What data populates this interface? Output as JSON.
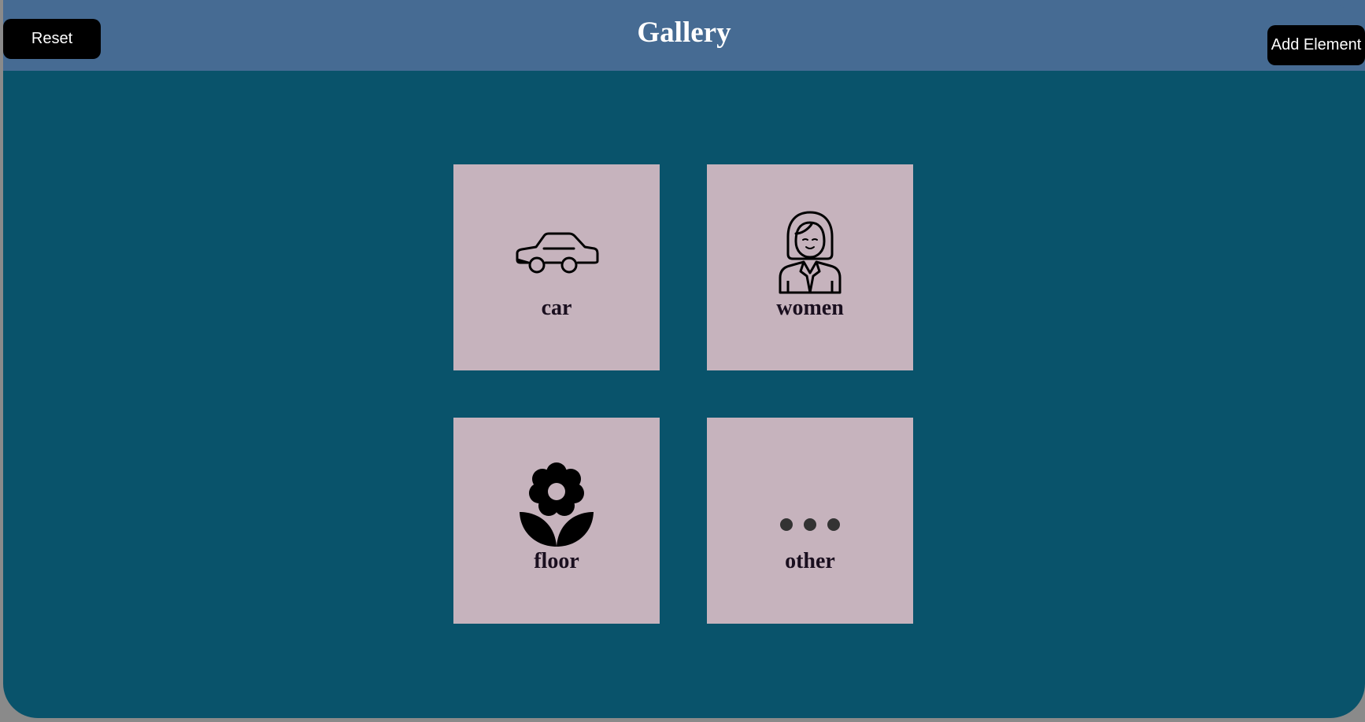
{
  "header": {
    "title": "Gallery",
    "reset_label": "Reset",
    "add_label": "Add Element"
  },
  "gallery": {
    "items": [
      {
        "label": "car",
        "icon": "car-icon"
      },
      {
        "label": "women",
        "icon": "woman-icon"
      },
      {
        "label": "floor",
        "icon": "flower-icon"
      },
      {
        "label": "other",
        "icon": "more-dots-icon"
      }
    ]
  },
  "colors": {
    "page_background": "#09536b",
    "header_background": "#466b93",
    "card_background": "#c6b3bd",
    "button_background": "#000000",
    "button_text": "#ffffff",
    "label_text": "#1a0f1f"
  }
}
